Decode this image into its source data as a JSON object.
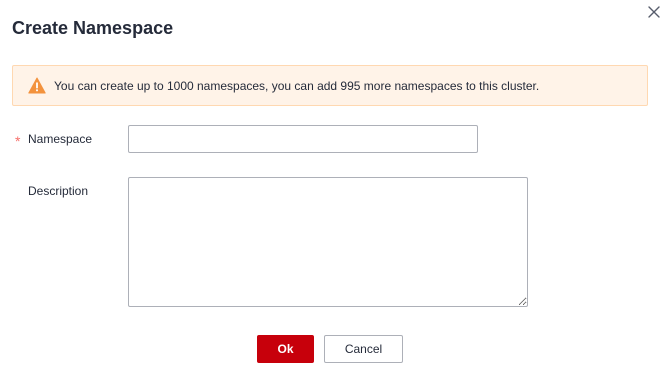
{
  "dialog": {
    "title": "Create Namespace",
    "close_icon": "close-icon"
  },
  "alert": {
    "icon": "warning-icon",
    "text": "You can create up to 1000 namespaces, you can add 995 more namespaces to this cluster.",
    "icon_color": "#f3923d"
  },
  "form": {
    "namespace": {
      "required_mark": "*",
      "label": "Namespace",
      "value": "",
      "placeholder": ""
    },
    "description": {
      "label": "Description",
      "value": "",
      "placeholder": ""
    }
  },
  "buttons": {
    "ok_label": "Ok",
    "cancel_label": "Cancel"
  },
  "colors": {
    "primary": "#c7000b",
    "required": "#f66f6a",
    "alert_background": "#fff3e8",
    "alert_border": "#ffd8b1"
  }
}
